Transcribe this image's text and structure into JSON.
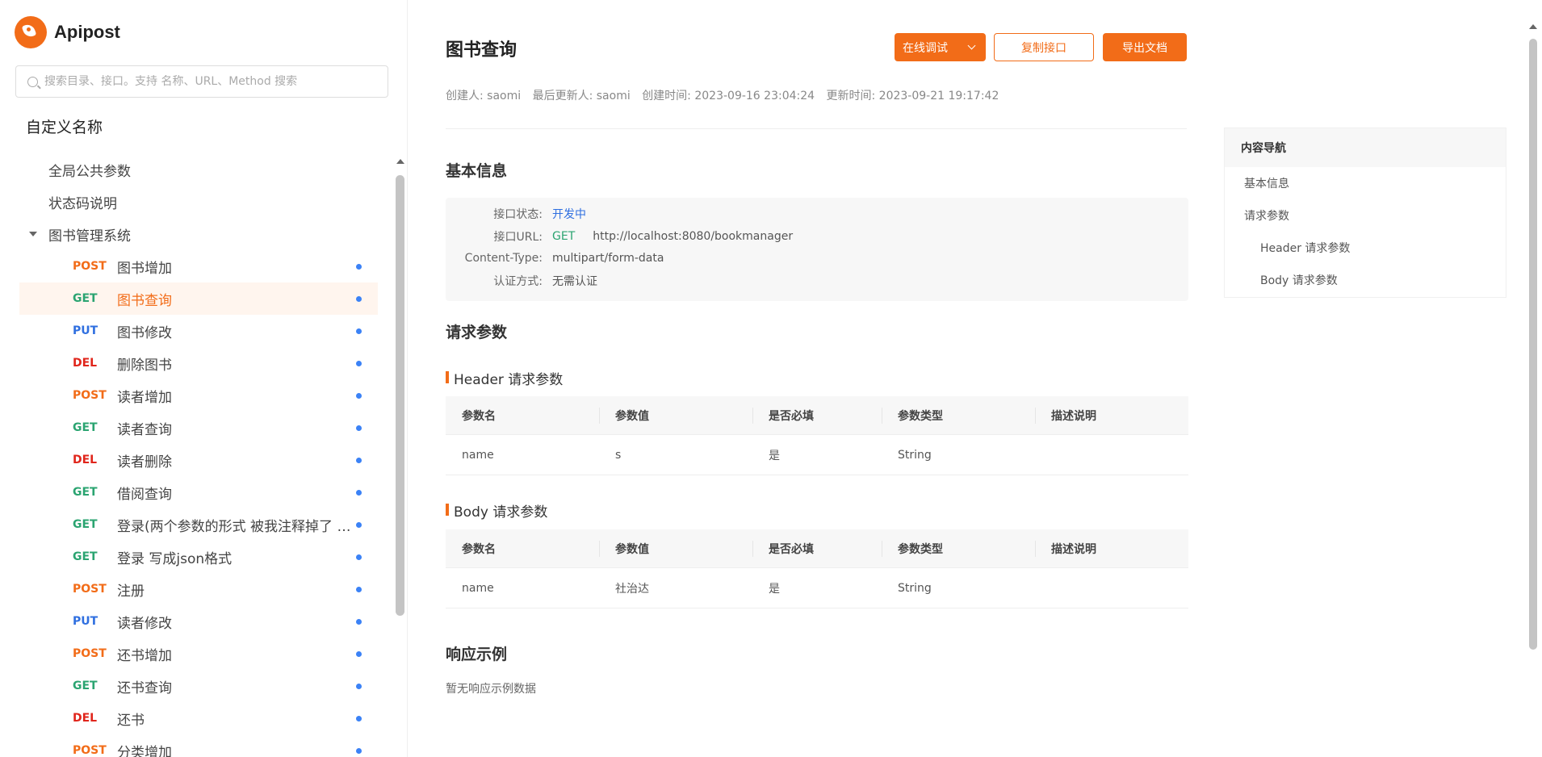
{
  "brand": {
    "name": "Apipost"
  },
  "search": {
    "placeholder": "搜索目录、接口。支持 名称、URL、Method 搜索"
  },
  "sidebar": {
    "project": "自定义名称",
    "top_items": [
      "全局公共参数",
      "状态码说明"
    ],
    "folder": "图书管理系统",
    "apis": [
      {
        "method": "POST",
        "name": "图书增加"
      },
      {
        "method": "GET",
        "name": "图书查询",
        "active": true
      },
      {
        "method": "PUT",
        "name": "图书修改"
      },
      {
        "method": "DEL",
        "name": "删除图书"
      },
      {
        "method": "POST",
        "name": "读者增加"
      },
      {
        "method": "GET",
        "name": "读者查询"
      },
      {
        "method": "DEL",
        "name": "读者删除"
      },
      {
        "method": "GET",
        "name": "借阅查询"
      },
      {
        "method": "GET",
        "name": "登录(两个参数的形式 被我注释掉了 现在是json格式)"
      },
      {
        "method": "GET",
        "name": "登录 写成json格式"
      },
      {
        "method": "POST",
        "name": "注册"
      },
      {
        "method": "PUT",
        "name": "读者修改"
      },
      {
        "method": "POST",
        "name": "还书增加"
      },
      {
        "method": "GET",
        "name": "还书查询"
      },
      {
        "method": "DEL",
        "name": "还书"
      },
      {
        "method": "POST",
        "name": "分类增加"
      }
    ]
  },
  "main": {
    "title": "图书查询",
    "buttons": {
      "debug": "在线调试",
      "copy": "复制接口",
      "export": "导出文档"
    },
    "meta": {
      "creator": "创建人: saomi",
      "updater": "最后更新人: saomi",
      "created": "创建时间: 2023-09-16 23:04:24",
      "updated": "更新时间: 2023-09-21 19:17:42"
    },
    "basic_info": {
      "title": "基本信息",
      "status_label": "接口状态:",
      "status_value": "开发中",
      "url_label": "接口URL:",
      "url_method": "GET",
      "url_value": "http://localhost:8080/bookmanager",
      "ctype_label": "Content-Type:",
      "ctype_value": "multipart/form-data",
      "auth_label": "认证方式:",
      "auth_value": "无需认证"
    },
    "request_params_title": "请求参数",
    "table_headers": [
      "参数名",
      "参数值",
      "是否必填",
      "参数类型",
      "描述说明"
    ],
    "header_params": {
      "title": "Header 请求参数",
      "rows": [
        [
          "name",
          "s",
          "是",
          "String",
          ""
        ]
      ]
    },
    "body_params": {
      "title": "Body 请求参数",
      "rows": [
        [
          "name",
          "社治达",
          "是",
          "String",
          ""
        ]
      ]
    },
    "response": {
      "title": "响应示例",
      "empty": "暂无响应示例数据"
    }
  },
  "toc": {
    "title": "内容导航",
    "items": [
      {
        "label": "基本信息",
        "sub": false
      },
      {
        "label": "请求参数",
        "sub": false
      },
      {
        "label": "Header 请求参数",
        "sub": true
      },
      {
        "label": "Body 请求参数",
        "sub": true
      }
    ]
  },
  "colors": {
    "accent": "#f26c18",
    "post": "#f26c18",
    "get": "#2ba471",
    "put": "#2f6fe0",
    "del": "#e0251b"
  }
}
